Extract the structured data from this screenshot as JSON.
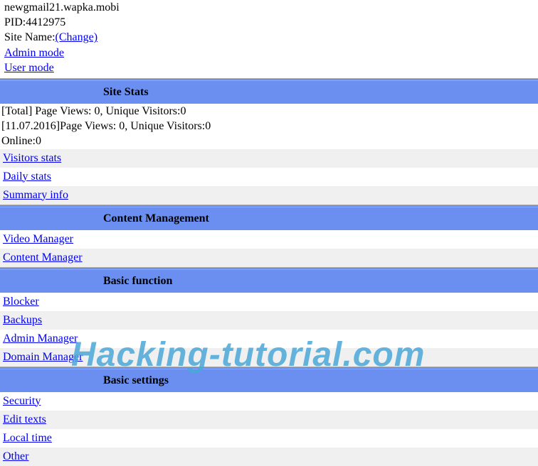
{
  "top": {
    "domain": "newgmail21.wapka.mobi",
    "pid_label": "PID:",
    "pid_value": "4412975",
    "site_name_label": "Site Name:",
    "change_link": "(Change)",
    "admin_mode": "Admin mode",
    "user_mode": "User mode"
  },
  "site_stats": {
    "header": "Site Stats",
    "total_line": "[Total] Page Views: 0, Unique Visitors:0",
    "date_line": "[11.07.2016]Page Views: 0, Unique Visitors:0",
    "online_line": "Online:0",
    "links": {
      "visitors": "Visitors stats",
      "daily": "Daily stats",
      "summary": "Summary info"
    }
  },
  "content_mgmt": {
    "header": "Content Management",
    "links": {
      "video": "Video Manager",
      "content": "Content Manager"
    }
  },
  "basic_function": {
    "header": "Basic function",
    "links": {
      "blocker": "Blocker",
      "backups": "Backups",
      "admin_mgr": "Admin Manager",
      "domain_mgr": "Domain Manager"
    }
  },
  "basic_settings": {
    "header": "Basic settings",
    "links": {
      "security": "Security",
      "edit_texts": "Edit texts",
      "local_time": "Local time",
      "other": "Other"
    }
  },
  "watermark": "Hacking-tutorial.com"
}
